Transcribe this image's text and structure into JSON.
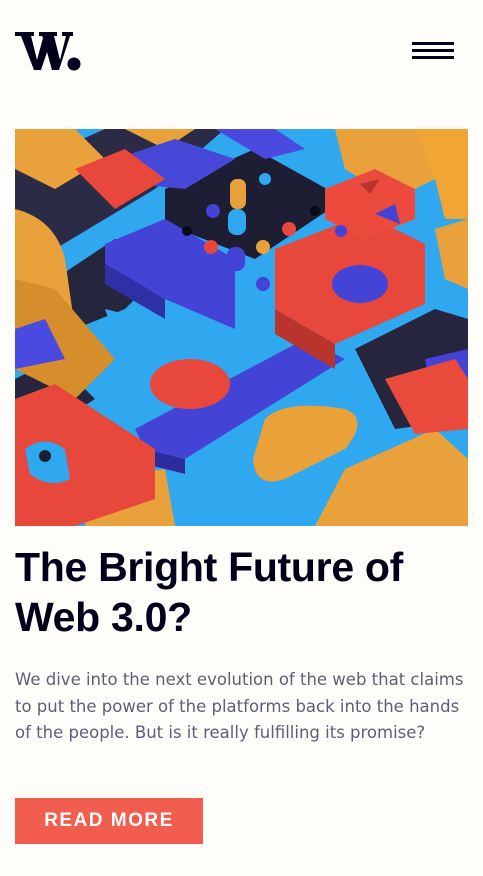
{
  "header": {
    "logo_text": "W.",
    "menu_icon": "hamburger-menu-icon"
  },
  "article": {
    "image_alt": "Colorful 3D geometric blocks",
    "title": "The Bright Future of Web 3.0?",
    "description": "We dive into the next evolution of the web that claims to put the power of the platforms back into the hands of the people. But is it really fulfilling its promise?",
    "cta_label": "READ MORE"
  },
  "colors": {
    "background": "#fffdf9",
    "text_dark": "#00001a",
    "text_muted": "#5d5f79",
    "accent": "#f15e50",
    "orange": "#e9a23b",
    "blue": "#4343d6",
    "cyan": "#2fa8f0"
  }
}
